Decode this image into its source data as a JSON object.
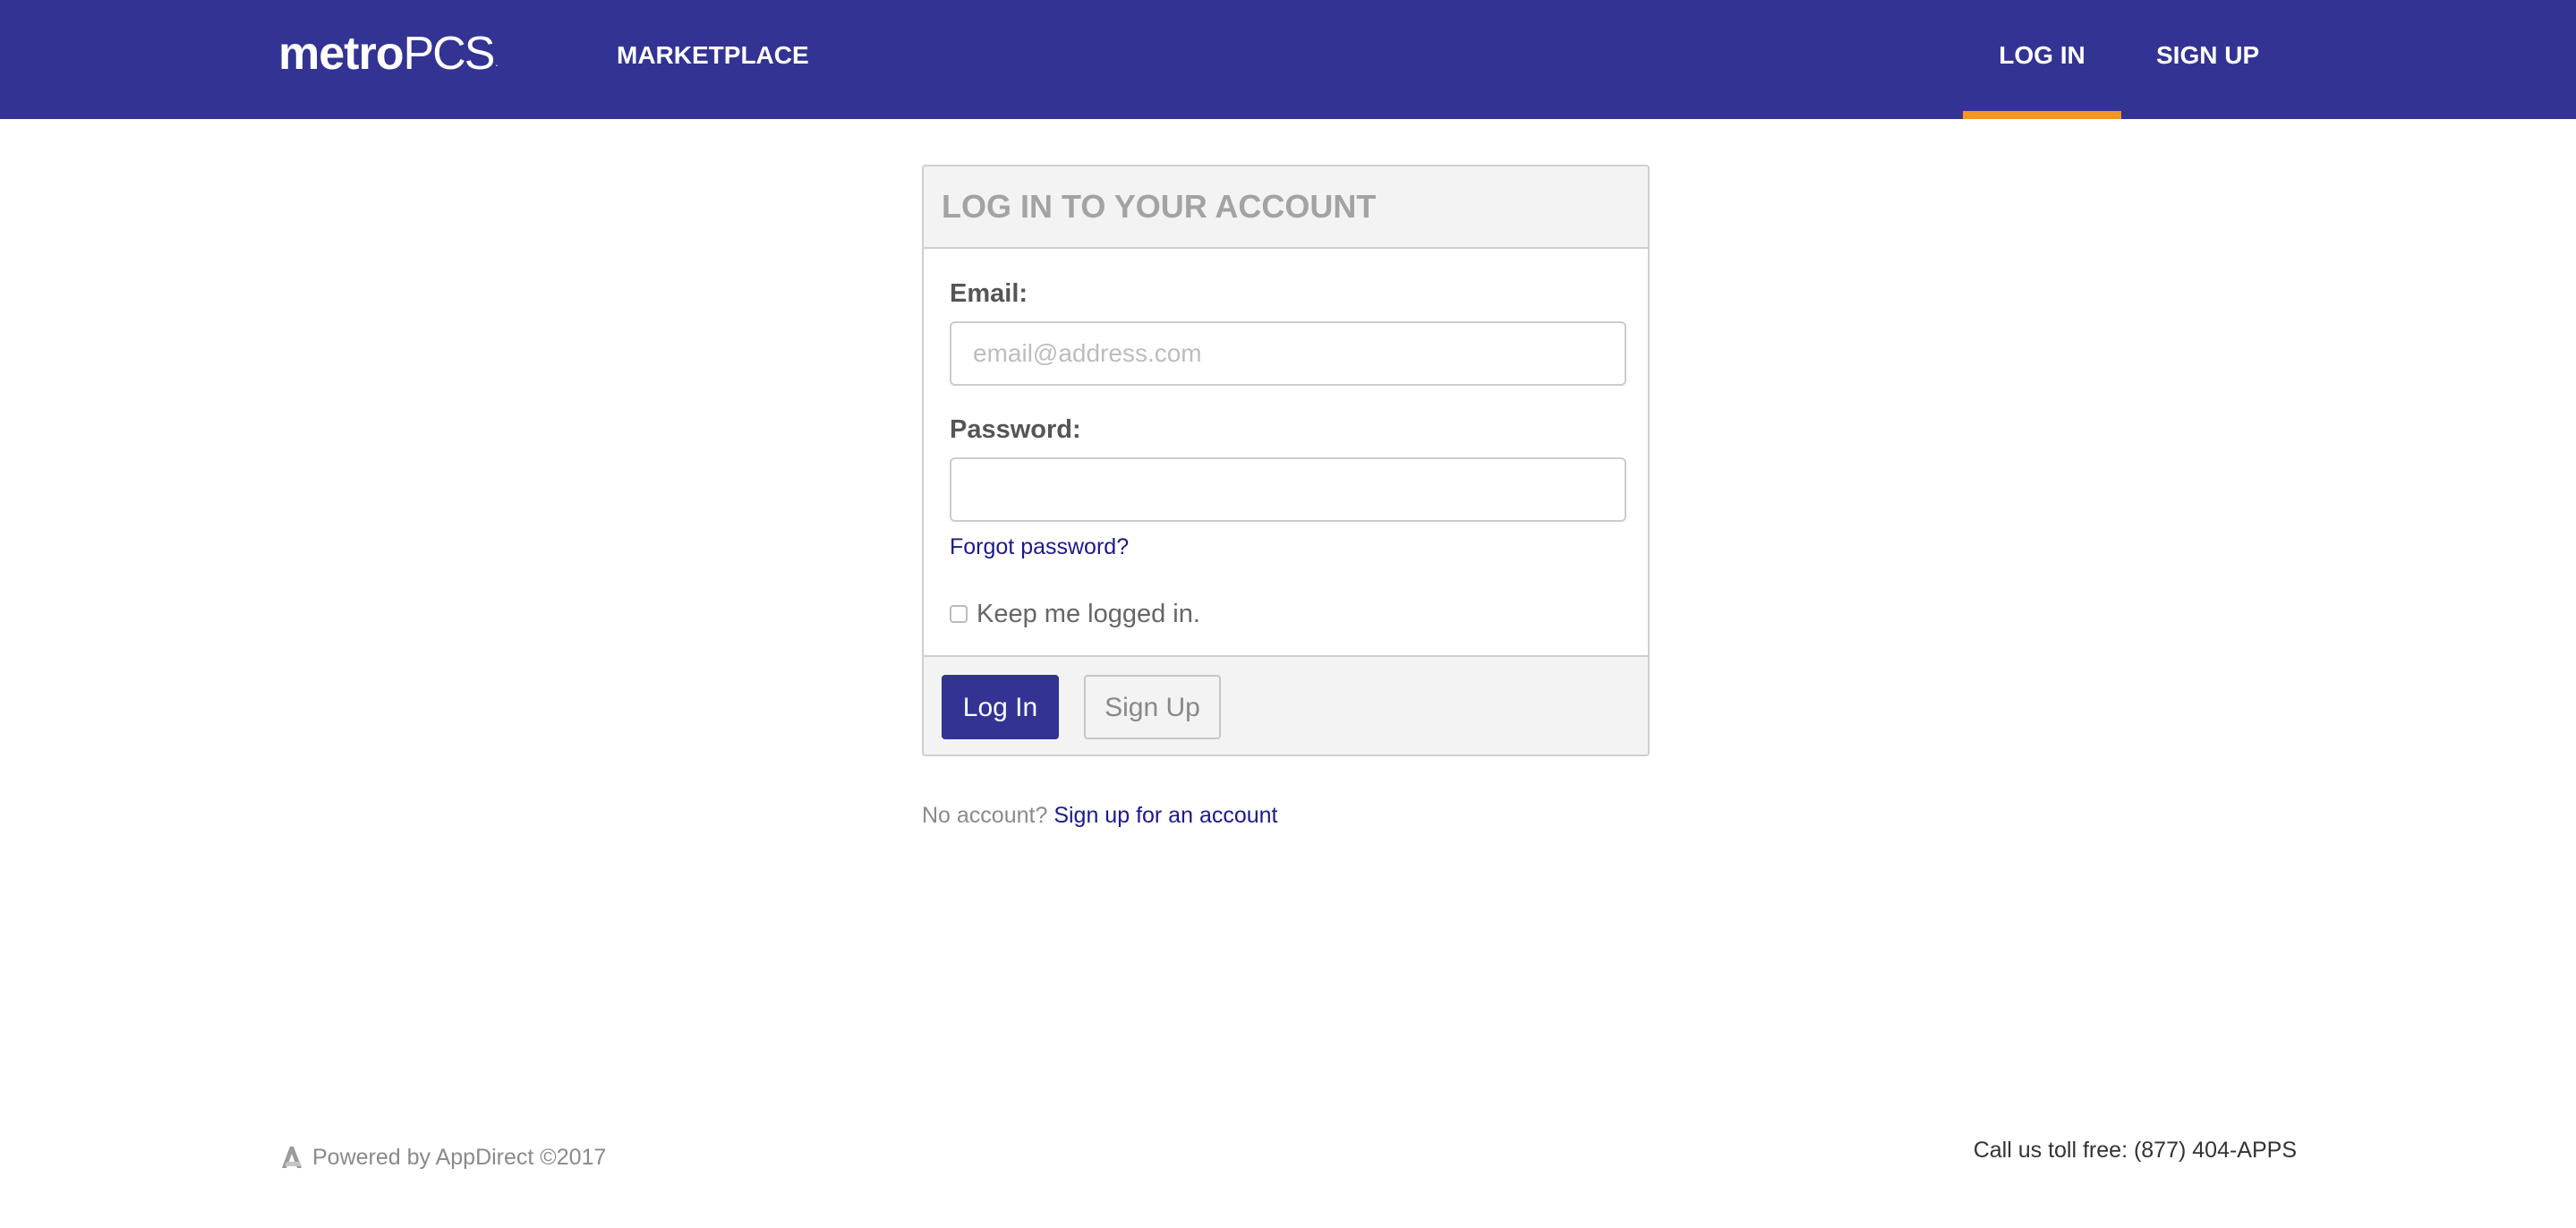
{
  "colors": {
    "brand": "#333394",
    "accent": "#f7941d",
    "link": "#1a1a8c"
  },
  "header": {
    "logo": {
      "bold": "metro",
      "light": "PCS",
      "mark": "."
    },
    "nav": {
      "marketplace": "MARKETPLACE",
      "login": "LOG IN",
      "signup": "SIGN UP",
      "active": "login"
    }
  },
  "login_panel": {
    "title": "LOG IN TO YOUR ACCOUNT",
    "email": {
      "label": "Email:",
      "value": "",
      "placeholder": "email@address.com"
    },
    "password": {
      "label": "Password:",
      "value": "",
      "placeholder": ""
    },
    "forgot_link": "Forgot password?",
    "remember": {
      "label": "Keep me logged in.",
      "checked": false
    },
    "buttons": {
      "login": "Log In",
      "signup": "Sign Up"
    }
  },
  "no_account": {
    "text": "No account?",
    "link": "Sign up for an account"
  },
  "footer": {
    "powered_icon": "appdirect-logo-icon",
    "powered": "Powered by AppDirect ©2017",
    "tollfree": "Call us toll free: (877) 404-APPS"
  }
}
